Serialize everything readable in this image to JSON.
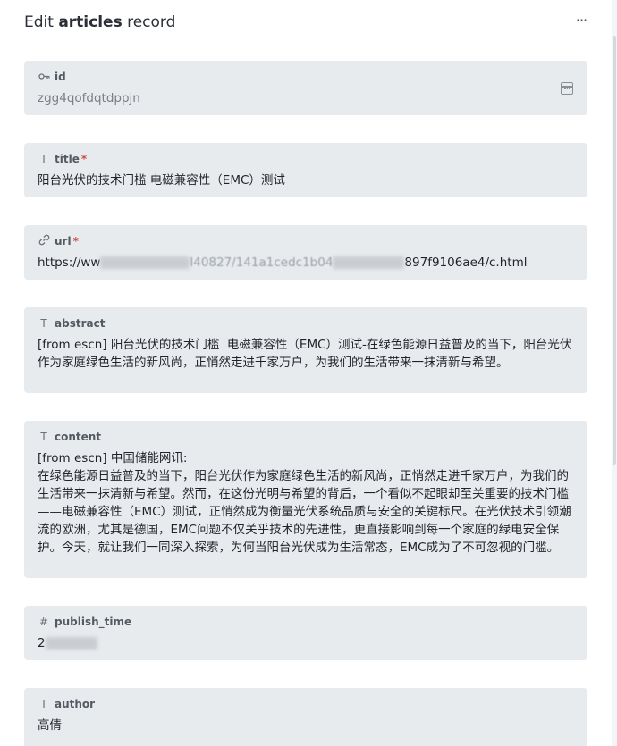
{
  "header": {
    "title_prefix": "Edit ",
    "title_table": "articles",
    "title_suffix": " record",
    "more_label": "···"
  },
  "fields": {
    "id": {
      "icon": "key-icon",
      "label": "id",
      "value": "zgg4qofdqtdppjn"
    },
    "title": {
      "icon": "text-icon",
      "label": "title",
      "required": "*",
      "value": "阳台光伏的技术门槛  电磁兼容性（EMC）测试"
    },
    "url": {
      "icon": "link-icon",
      "label": "url",
      "required": "*",
      "value_start": "https://ww",
      "value_mid": "l40827/141a1cedc1b04",
      "value_end": "897f9106ae4/c.html"
    },
    "abstract": {
      "icon": "text-icon",
      "label": "abstract",
      "value": "[from escn] 阳台光伏的技术门槛  电磁兼容性（EMC）测试-在绿色能源日益普及的当下，阳台光伏作为家庭绿色生活的新风尚，正悄然走进千家万户，为我们的生活带来一抹清新与希望。"
    },
    "content": {
      "icon": "text-icon",
      "label": "content",
      "value": "[from escn] 中国储能网讯:\n在绿色能源日益普及的当下，阳台光伏作为家庭绿色生活的新风尚，正悄然走进千家万户，为我们的生活带来一抹清新与希望。然而，在这份光明与希望的背后，一个看似不起眼却至关重要的技术门槛——电磁兼容性（EMC）测试，正悄然成为衡量光伏系统品质与安全的关键标尺。在光伏技术引领潮流的欧洲，尤其是德国，EMC问题不仅关乎技术的先进性，更直接影响到每一个家庭的绿电安全保护。今天，就让我们一同深入探索，为何当阳台光伏成为生活常态，EMC成为了不可忽视的门槛。"
    },
    "publish_time": {
      "icon": "hash-icon",
      "label": "publish_time",
      "value": "2"
    },
    "author": {
      "icon": "text-icon",
      "label": "author",
      "value": "高倩"
    }
  },
  "colors": {
    "card_bg": "#e8ebee",
    "required": "#d64a4a",
    "text": "#1f2329",
    "label": "#545a62"
  }
}
